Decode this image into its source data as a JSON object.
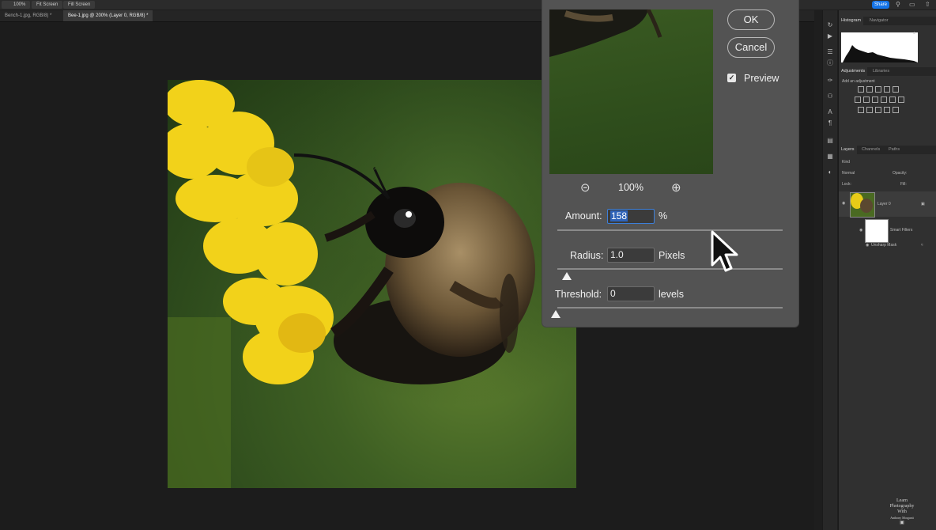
{
  "options_bar": {
    "zoom": "100%",
    "buttons": [
      "Fit Screen",
      "Fill Screen"
    ],
    "share_label": "Share"
  },
  "tabs": [
    {
      "label": "Bench-1.jpg, RGB/8) *",
      "active": false
    },
    {
      "label": "Bee-1.jpg @ 200% (Layer 0, RGB/8) *",
      "active": true
    }
  ],
  "dialog": {
    "ok_label": "OK",
    "cancel_label": "Cancel",
    "preview_label": "Preview",
    "preview_checked": true,
    "zoom_value": "100%",
    "amount": {
      "label": "Amount:",
      "value": "158",
      "unit": "%",
      "slider_fraction": 0.69
    },
    "radius": {
      "label": "Radius:",
      "value": "1.0",
      "unit": "Pixels",
      "slider_fraction": 0.04
    },
    "threshold": {
      "label": "Threshold:",
      "value": "0",
      "unit": "levels",
      "slider_fraction": 0.0
    }
  },
  "panels": {
    "top_tabs": [
      "Histogram",
      "Navigator"
    ],
    "mid_tabs": [
      "Adjustments",
      "Libraries"
    ],
    "add_adjustment": "Add an adjustment",
    "layer_tabs": [
      "Layers",
      "Channels",
      "Paths"
    ],
    "filter_kind": "Kind",
    "blend_mode": "Normal",
    "opacity_label": "Opacity:",
    "lock_label": "Lock:",
    "fill_label": "Fill:",
    "layers": [
      {
        "name": "Layer 0"
      },
      {
        "name": "Smart Filters"
      },
      {
        "name": "Unsharp Mask"
      }
    ]
  },
  "watermark": [
    "Learn",
    "Photography",
    "With",
    "Anthony Morganti"
  ]
}
